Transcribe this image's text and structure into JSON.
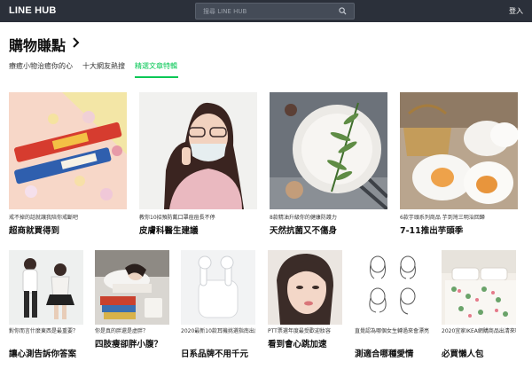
{
  "header": {
    "logo": "LINE HUB",
    "search_placeholder": "搜尋 LINE HUB",
    "login": "登入"
  },
  "page": {
    "title": "購物賺點"
  },
  "tabs": [
    {
      "label": "療癒小物治癒你的心"
    },
    {
      "label": "十大網友熱搜"
    },
    {
      "label": "精選文章特輯",
      "active": true
    }
  ],
  "row1": [
    {
      "desc": "戒不掉的話就讓我陪你戒斷吧",
      "title": "超商就買得到"
    },
    {
      "desc": "教你10招預防戴口罩痘痘長不停",
      "title": "皮膚科醫生建議"
    },
    {
      "desc": "8款精油升級你的健康防護力",
      "title": "天然抗菌又不傷身"
    },
    {
      "desc": "6款芋頭系列商品 芋到灣三明治回歸",
      "title": "7-11推出芋頭季"
    }
  ],
  "row2": [
    {
      "desc": "對你而言什麼東西是最重要？",
      "title": "讓心測告訴你答案"
    },
    {
      "desc": "你是真的胖還是虛胖？",
      "title": "四肢瘦卻胖小腹？"
    },
    {
      "desc": "2020最新10款耳機挑選指南出爐",
      "title": "日系品牌不用千元"
    },
    {
      "desc": "PTT票選年度最受歡迎妝容",
      "title": "看到會心跳加速"
    },
    {
      "desc": "直覺認為哪個女生轉過來會漂亮",
      "title": "測適合哪種愛情"
    },
    {
      "desc": "2020宜家IKEA網購商品出清來囉！",
      "title": "必買懶人包"
    }
  ],
  "colors": {
    "accent": "#06c755",
    "topbar": "#2b303a"
  },
  "icons": {
    "search": "search-icon",
    "title_arrow": "chevron-right-icon"
  }
}
